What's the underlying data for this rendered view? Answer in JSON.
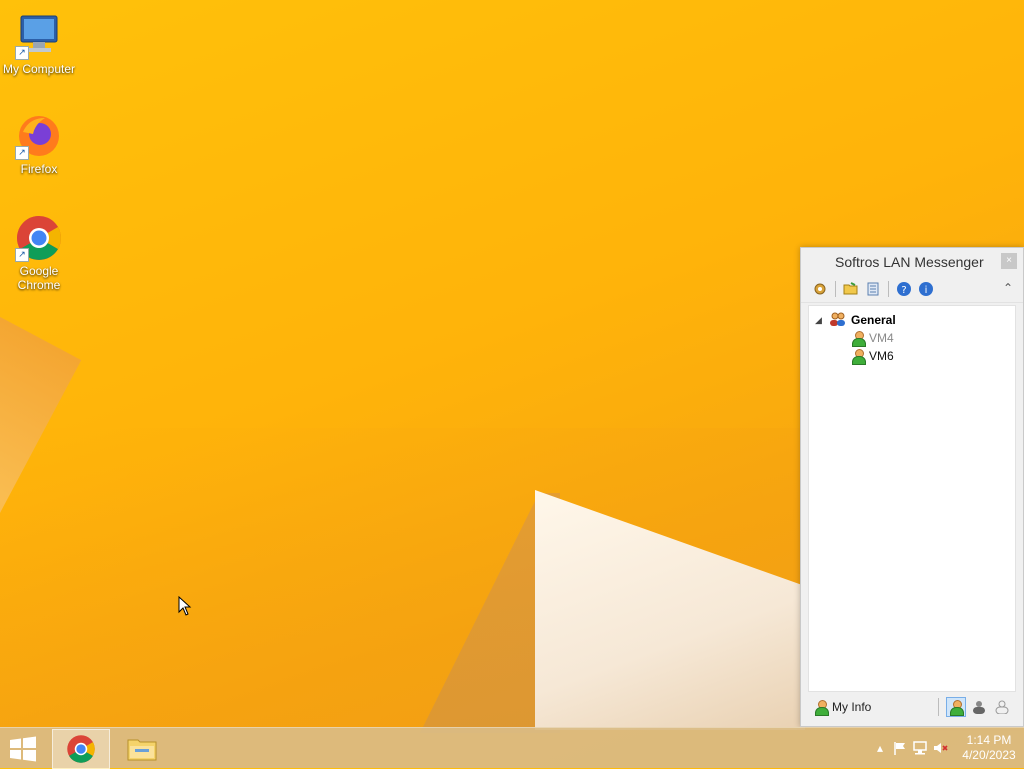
{
  "desktop": {
    "icons": [
      {
        "label": "My Computer"
      },
      {
        "label": "Firefox"
      },
      {
        "label": "Google\nChrome"
      }
    ]
  },
  "messenger": {
    "title": "Softros LAN Messenger",
    "close_label": "×",
    "group": {
      "name": "General"
    },
    "users": [
      {
        "name": "VM4",
        "status": "offline"
      },
      {
        "name": "VM6",
        "status": "online"
      }
    ],
    "my_info_label": "My Info"
  },
  "taskbar": {
    "time": "1:14 PM",
    "date": "4/20/2023"
  },
  "colors": {
    "wallpaper": "#ffb30a",
    "taskbar": "#dabc84",
    "offline_text": "#8a8a8a"
  }
}
